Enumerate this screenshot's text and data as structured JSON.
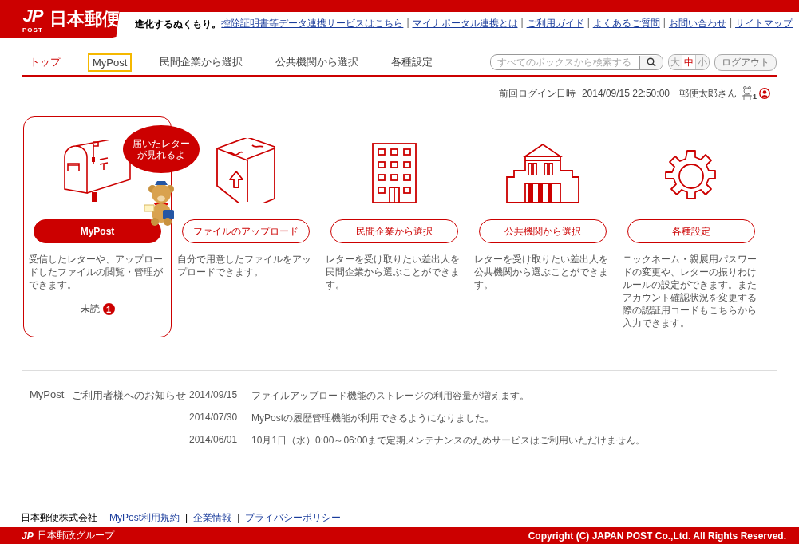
{
  "header": {
    "logo_mark": "JP",
    "logo_sub": "POST",
    "logo_text": "日本郵便",
    "tagline": "進化するぬくもり。",
    "links": [
      "控除証明書等データ連携サービスはこちら",
      "マイナポータル連携とは",
      "ご利用ガイド",
      "よくあるご質問",
      "お問い合わせ",
      "サイトマップ"
    ],
    "separators": [
      "|",
      "|",
      "|",
      "|",
      "|"
    ]
  },
  "nav": {
    "items": [
      {
        "label": "トップ",
        "selected": true,
        "focused": false
      },
      {
        "label": "MyPost",
        "selected": false,
        "focused": true
      },
      {
        "label": "民間企業から選択",
        "selected": false,
        "focused": false
      },
      {
        "label": "公共機関から選択",
        "selected": false,
        "focused": false
      },
      {
        "label": "各種設定",
        "selected": false,
        "focused": false
      }
    ],
    "search": {
      "placeholder": "すべてのボックスから検索する"
    },
    "font_sizes": [
      {
        "label": "大",
        "selected": false
      },
      {
        "label": "中",
        "selected": true
      },
      {
        "label": "小",
        "selected": false
      }
    ],
    "logout": "ログアウト"
  },
  "login_info": {
    "label": "前回ログイン日時",
    "datetime": "2014/09/15 22:50:00",
    "user": "郵便太郎さん",
    "notification_count": "1"
  },
  "cards": [
    {
      "kind": "mailbox",
      "title": "MyPost",
      "selected": true,
      "description": "受信したレターや、アップロードしたファイルの閲覧・管理ができます。",
      "bubble": [
        "届いたレター",
        "が見れるよ"
      ],
      "unread_label": "未読",
      "unread_count": "1"
    },
    {
      "kind": "upload",
      "title": "ファイルのアップロード",
      "selected": false,
      "description": "自分で用意したファイルをアップロードできます。"
    },
    {
      "kind": "company",
      "title": "民間企業から選択",
      "selected": false,
      "description": "レターを受け取りたい差出人を民間企業から選ぶことができます。"
    },
    {
      "kind": "public",
      "title": "公共機関から選択",
      "selected": false,
      "description": "レターを受け取りたい差出人を公共機関から選ぶことができます。"
    },
    {
      "kind": "settings",
      "title": "各種設定",
      "selected": false,
      "description": "ニックネーム・親展用パスワードの変更や、レターの振りわけルールの設定ができます。またアカウント確認状況を変更する際の認証用コードもこちらから入力できます。"
    }
  ],
  "notices": {
    "title": "MyPost",
    "subtitle": "ご利用者様へのお知らせ",
    "items": [
      {
        "date": "2014/09/15",
        "text": "ファイルアップロード機能のストレージの利用容量が増えます。"
      },
      {
        "date": "2014/07/30",
        "text": "MyPostの履歴管理機能が利用できるようになりました。"
      },
      {
        "date": "2014/06/01",
        "text": "10月1日（水）0:00～06:00まで定期メンテナンスのためサービスはご利用いただけません。"
      }
    ]
  },
  "footer": {
    "company": "日本郵便株式会社",
    "links": [
      "MyPost利用規約",
      "企業情報",
      "プライバシーポリシー"
    ],
    "separators": [
      "|",
      "|"
    ],
    "logo_mark": "JP",
    "group": "日本郵政グループ",
    "copyright": "Copyright (C) JAPAN POST Co.,Ltd. All Rights Reserved."
  }
}
